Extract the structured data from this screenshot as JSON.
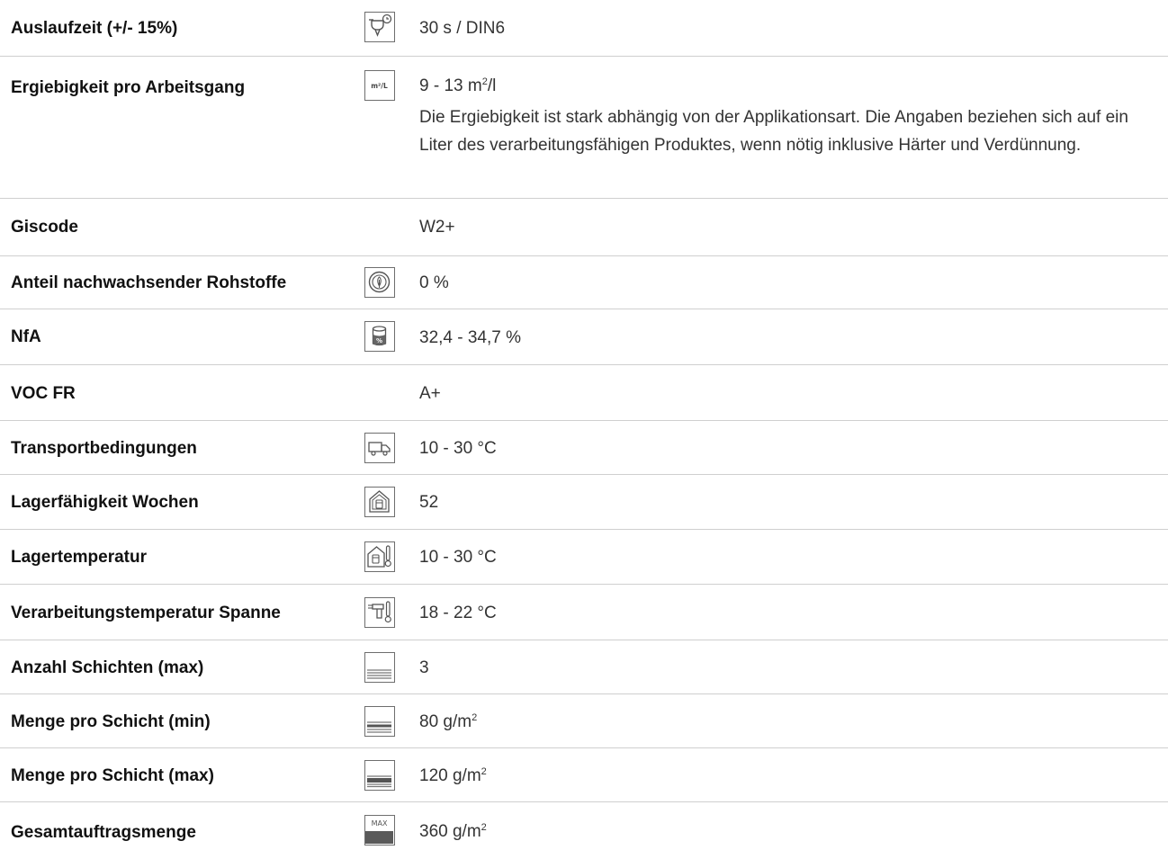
{
  "rows": [
    {
      "label": "Auslaufzeit (+/- 15%)",
      "icon": "flow-cup-timer-icon",
      "value": "30 s / DIN6"
    },
    {
      "label": "Ergiebigkeit pro Arbeitsgang",
      "icon": "m2-per-liter-icon",
      "value_main": "9 - 13 m",
      "value_sup": "2",
      "value_tail": "/l",
      "icon_text": "m²/L",
      "description": "Die Ergiebigkeit ist stark abhängig von der Applikationsart. Die Angaben beziehen sich auf ein Liter des verarbeitungsfähigen Produktes, wenn nötig inklusive Härter und Verdünnung."
    },
    {
      "label": "Giscode",
      "icon": "",
      "value": "W2+"
    },
    {
      "label": "Anteil nachwachsender Rohstoffe",
      "icon": "renewable-leaf-icon",
      "value": "0 %"
    },
    {
      "label": "NfA",
      "icon": "non-volatile-content-can-icon",
      "value": "32,4 - 34,7 %"
    },
    {
      "label": "VOC FR",
      "icon": "",
      "value": "A+"
    },
    {
      "label": "Transportbedingungen",
      "icon": "truck-icon",
      "value": "10 - 30 °C"
    },
    {
      "label": "Lagerfähigkeit Wochen",
      "icon": "storage-house-icon",
      "value": "52"
    },
    {
      "label": "Lagertemperatur",
      "icon": "storage-temperature-icon",
      "value": "10 - 30 °C"
    },
    {
      "label": "Verarbeitungstemperatur Spanne",
      "icon": "spray-gun-temperature-icon",
      "value": "18 - 22 °C"
    },
    {
      "label": "Anzahl Schichten (max)",
      "icon": "layers-icon",
      "value": "3"
    },
    {
      "label": "Menge pro Schicht (min)",
      "icon": "layer-amount-min-icon",
      "value_main": "80 g/m",
      "value_sup": "2"
    },
    {
      "label": "Menge pro Schicht (max)",
      "icon": "layer-amount-max-icon",
      "value_main": "120 g/m",
      "value_sup": "2"
    },
    {
      "label": "Gesamtauftragsmenge",
      "icon": "max-total-amount-icon",
      "icon_text": "MAX",
      "value_main": "360 g/m",
      "value_sup": "2"
    }
  ]
}
